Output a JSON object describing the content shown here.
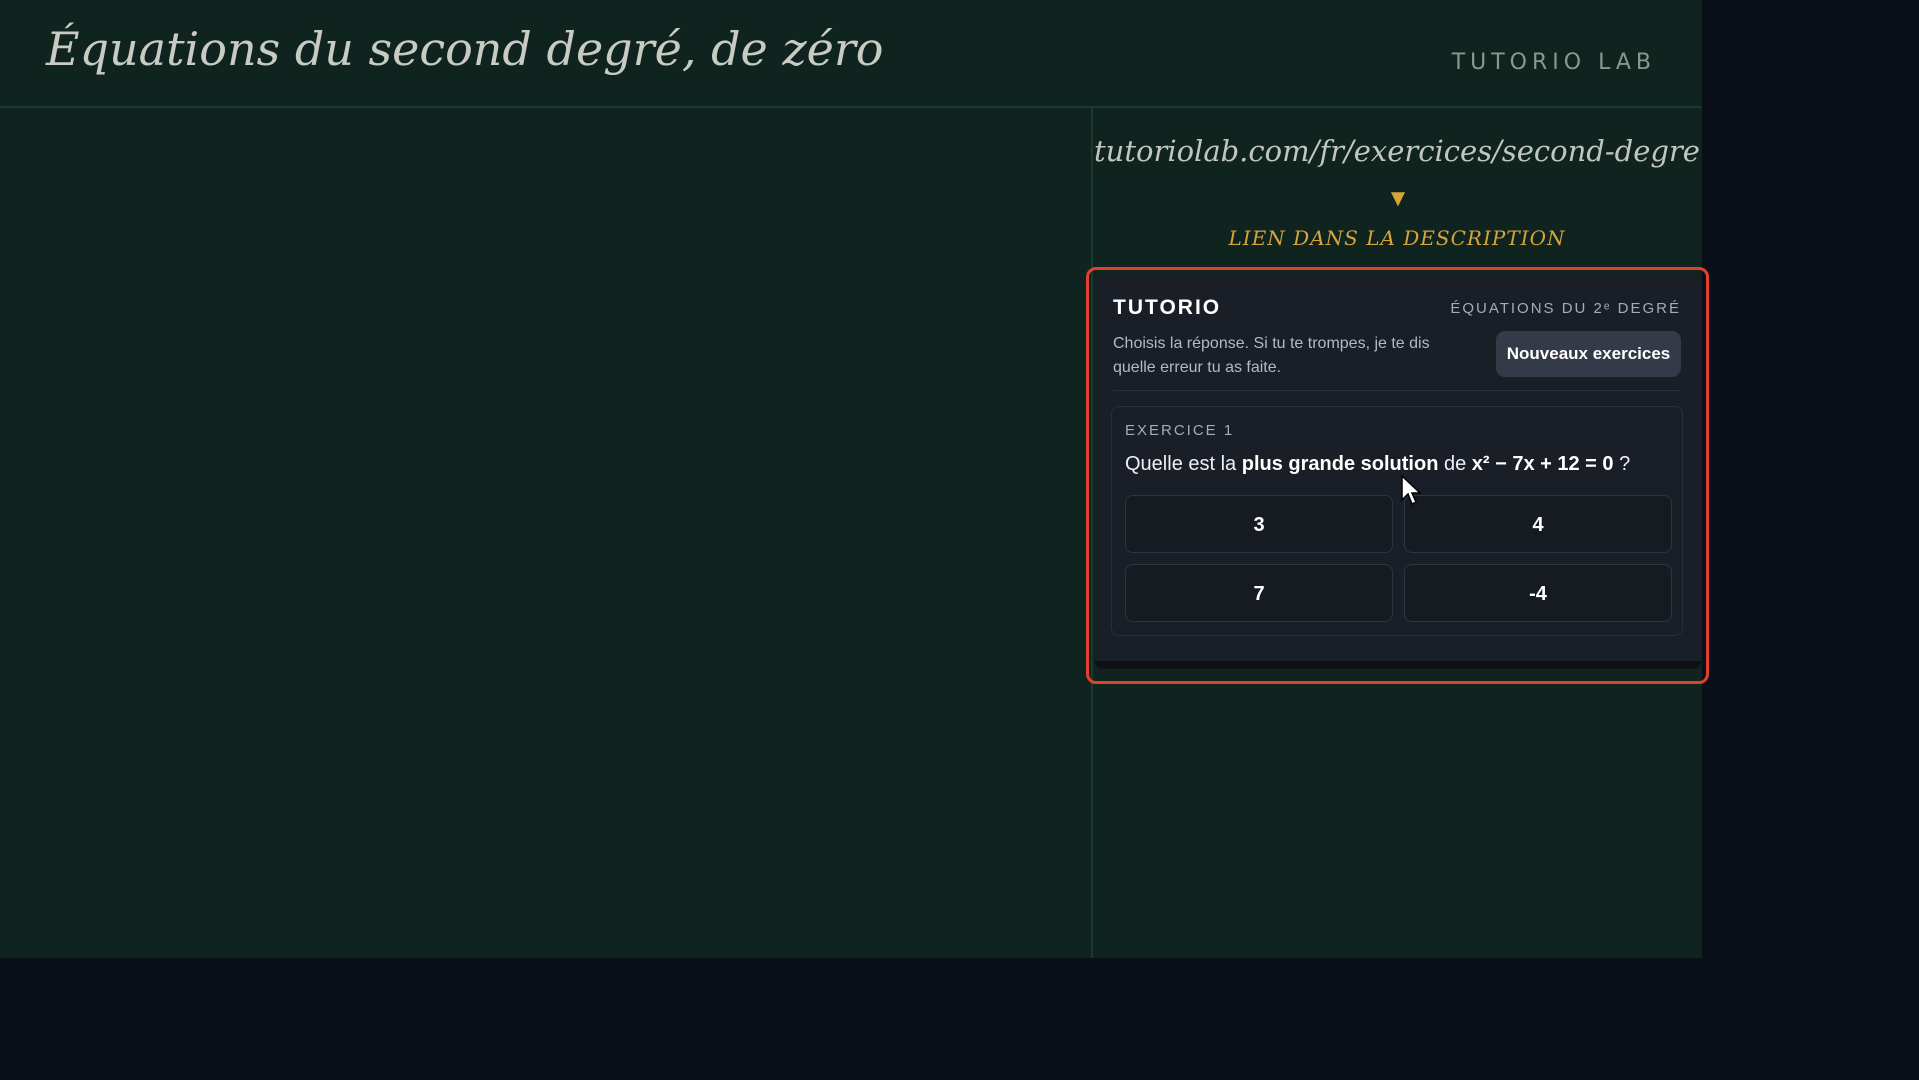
{
  "header": {
    "title": "Équations du second degré, de zéro",
    "brand": "TUTORIO LAB"
  },
  "sidebar": {
    "url": "tutoriolab.com/fr/exercices/second-degre",
    "arrow_icon": "down-triangle-icon",
    "link_hint": "LIEN DANS LA DESCRIPTION"
  },
  "card": {
    "brand": "TUTORIO",
    "topic": "ÉQUATIONS DU 2ᵉ DEGRÉ",
    "hint": "Choisis la réponse. Si tu te trompes, je te dis quelle erreur tu as faite.",
    "new_button": "Nouveaux exercices",
    "exercise": {
      "label": "EXERCICE 1",
      "question_prefix": "Quelle est la ",
      "question_bold": "plus grande solution",
      "question_mid": " de ",
      "question_equation": "x² − 7x + 12 = 0",
      "question_suffix": " ?",
      "answers": [
        "3",
        "4",
        "7",
        "-4"
      ]
    }
  },
  "colors": {
    "board": "#0f241e",
    "accent": "#d6a43b",
    "highlight": "#e0402f",
    "card": "#1a1e26"
  }
}
